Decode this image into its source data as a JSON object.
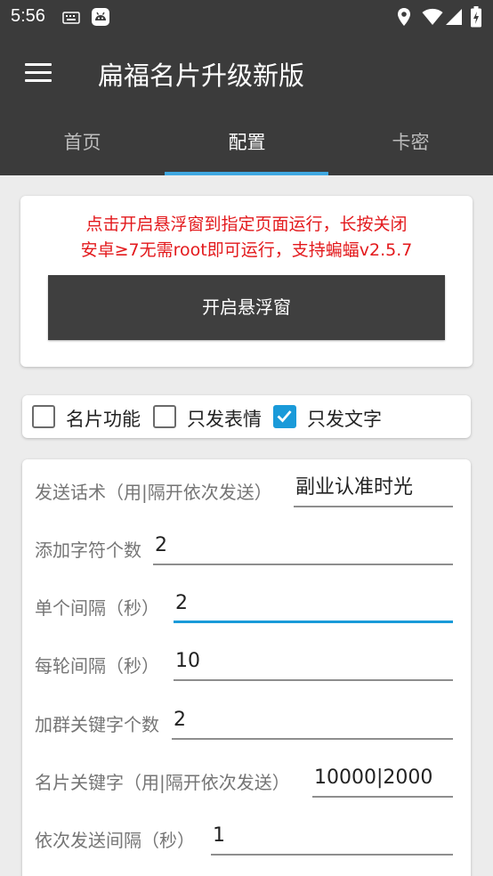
{
  "status_bar": {
    "time": "5:56",
    "icons": [
      "keyboard-icon",
      "android-icon",
      "location-icon",
      "wifi-icon",
      "signal-icon",
      "battery-icon"
    ]
  },
  "app_bar": {
    "title": "扁福名片升级新版",
    "menu_icon": "hamburger-menu-icon"
  },
  "tabs": [
    {
      "label": "首页",
      "active": false
    },
    {
      "label": "配置",
      "active": true
    },
    {
      "label": "卡密",
      "active": false
    }
  ],
  "notice": {
    "line1": "点击开启悬浮窗到指定页面运行，长按关闭",
    "line2": "安卓≥7无需root即可运行，支持蝙蝠v2.5.7",
    "button_label": "开启悬浮窗"
  },
  "options": [
    {
      "label": "名片功能",
      "checked": false
    },
    {
      "label": "只发表情",
      "checked": false
    },
    {
      "label": "只发文字",
      "checked": true
    }
  ],
  "settings": [
    {
      "label": "发送话术（用|隔开依次发送）",
      "value": "副业认准时光"
    },
    {
      "label": "添加字符个数",
      "value": "2"
    },
    {
      "label": "单个间隔（秒）",
      "value": "2"
    },
    {
      "label": "每轮间隔（秒）",
      "value": "10"
    },
    {
      "label": "加群关键字个数",
      "value": "2"
    },
    {
      "label": "名片关键字（用|隔开依次发送）",
      "value": "10000|2000"
    },
    {
      "label": "依次发送间隔（秒）",
      "value": "1"
    }
  ],
  "colors": {
    "bar_bg": "#3b3b3b",
    "accent": "#1a9ad9",
    "tab_indicator": "#3fa7e0",
    "notice_text": "#e3191c",
    "page_bg": "#ececec"
  }
}
